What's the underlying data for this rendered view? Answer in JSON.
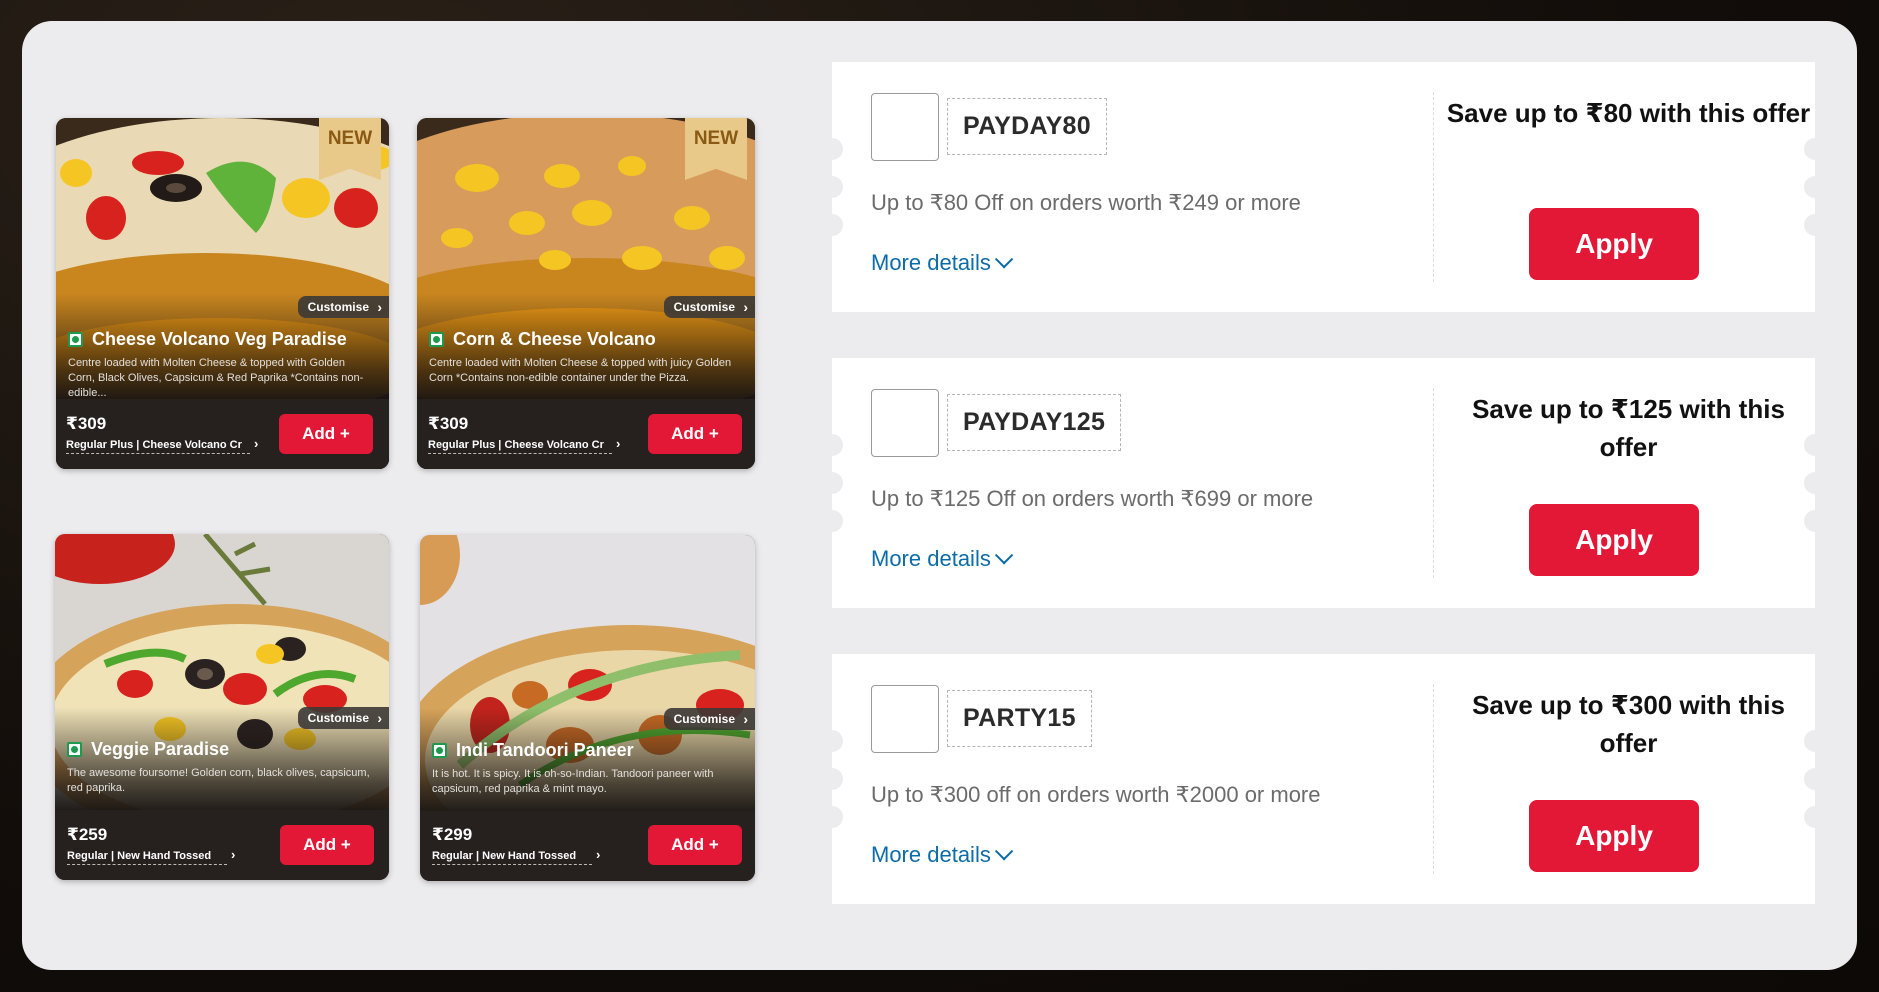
{
  "pizzas": [
    {
      "name": "Cheese Volcano Veg Paradise",
      "badge": "NEW",
      "customise_label": "Customise",
      "description": "Centre loaded with Molten Cheese & topped with Golden Corn, Black Olives, Capsicum & Red Paprika *Contains non-edible...",
      "price": "₹309",
      "size": "Regular Plus",
      "crust": "Cheese Volcano Cr",
      "add_label": "Add +"
    },
    {
      "name": "Corn & Cheese Volcano",
      "badge": "NEW",
      "customise_label": "Customise",
      "description": "Centre loaded with Molten Cheese & topped with juicy Golden Corn *Contains non-edible container under the Pizza.",
      "price": "₹309",
      "size": "Regular Plus",
      "crust": "Cheese Volcano Cr",
      "add_label": "Add +"
    },
    {
      "name": "Veggie Paradise",
      "customise_label": "Customise",
      "description": "The awesome foursome! Golden corn, black olives, capsicum, red paprika.",
      "price": "₹259",
      "size": "Regular",
      "crust": "New Hand Tossed",
      "add_label": "Add +"
    },
    {
      "name": "Indi Tandoori Paneer",
      "customise_label": "Customise",
      "description": "It is hot. It is spicy. It is oh-so-Indian. Tandoori paneer with capsicum, red paprika & mint mayo.",
      "price": "₹299",
      "size": "Regular",
      "crust": "New Hand Tossed",
      "add_label": "Add +"
    }
  ],
  "coupons": [
    {
      "code": "PAYDAY80",
      "description": "Up to ₹80 Off on orders worth ₹249 or more",
      "more_details": "More details",
      "save_text": "Save up to ₹80 with this offer",
      "apply_label": "Apply"
    },
    {
      "code": "PAYDAY125",
      "description": "Up to ₹125 Off on orders worth ₹699 or more",
      "more_details": "More details",
      "save_text": "Save up to ₹125 with this offer",
      "apply_label": "Apply"
    },
    {
      "code": "PARTY15",
      "description": "Up to ₹300 off on orders worth ₹2000 or more",
      "more_details": "More details",
      "save_text": "Save up to ₹300 with this offer",
      "apply_label": "Apply"
    }
  ],
  "colors": {
    "brand_red": "#e31837",
    "link_blue": "#0c6ca8",
    "veg_green": "#1c9a4d",
    "panel_bg": "#ececee"
  }
}
